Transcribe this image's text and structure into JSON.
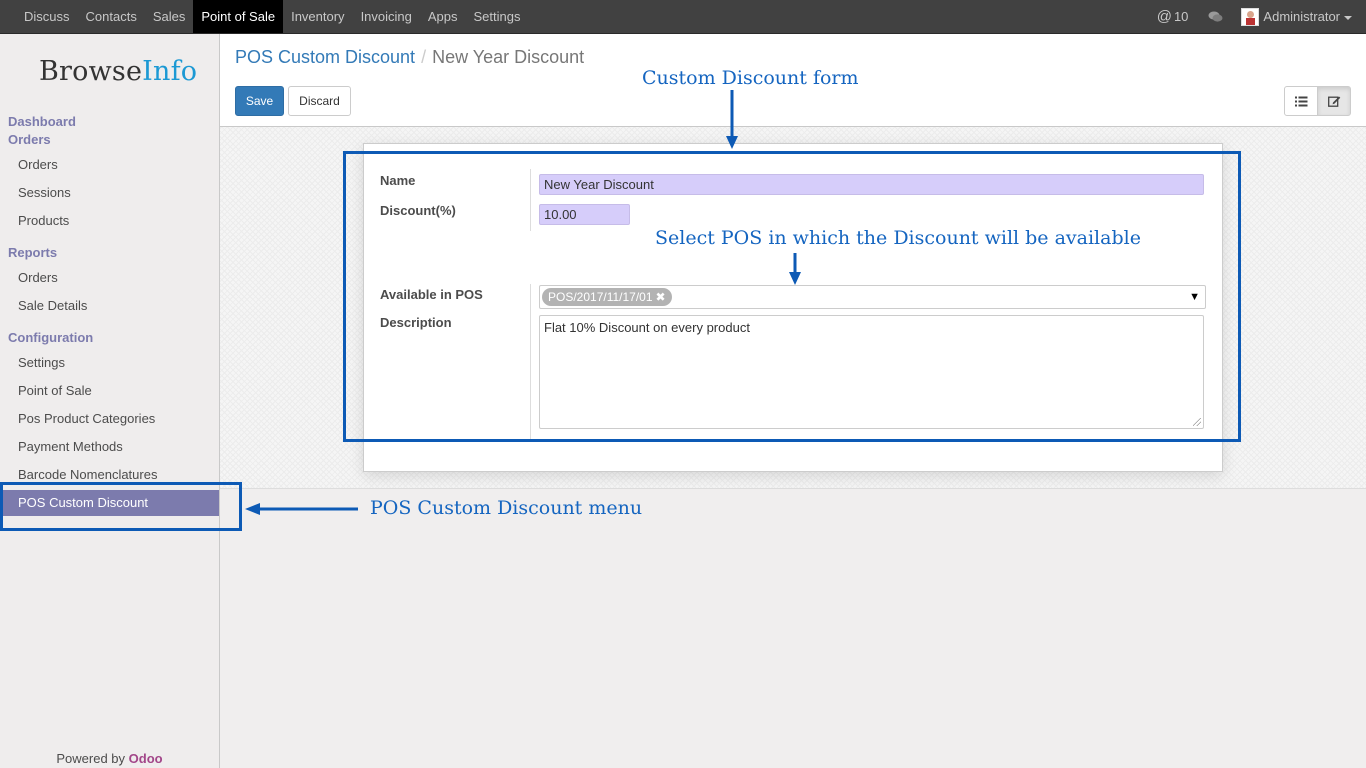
{
  "topbar": {
    "nav": [
      {
        "label": "Discuss"
      },
      {
        "label": "Contacts"
      },
      {
        "label": "Sales"
      },
      {
        "label": "Point of Sale",
        "active": true
      },
      {
        "label": "Inventory"
      },
      {
        "label": "Invoicing"
      },
      {
        "label": "Apps"
      },
      {
        "label": "Settings"
      }
    ],
    "mention_count": "10",
    "user_name": "Administrator"
  },
  "sidebar": {
    "logo_browse": "Browse",
    "logo_info": "Info",
    "sections": [
      {
        "label": "Dashboard"
      },
      {
        "label": "Orders",
        "items": [
          "Orders",
          "Sessions",
          "Products"
        ]
      },
      {
        "label": "Reports",
        "items": [
          "Orders",
          "Sale Details"
        ]
      },
      {
        "label": "Configuration",
        "items": [
          "Settings",
          "Point of Sale",
          "Pos Product Categories",
          "Payment Methods",
          "Barcode Nomenclatures",
          "POS Custom Discount"
        ]
      }
    ],
    "active_item": "POS Custom Discount",
    "powered_by": "Powered by",
    "powered_brand": "Odoo"
  },
  "controlpanel": {
    "breadcrumb_parent": "POS Custom Discount",
    "breadcrumb_separator": "/",
    "breadcrumb_current": "New Year Discount",
    "save_label": "Save",
    "discard_label": "Discard",
    "view_icons": [
      "list-view-icon",
      "form-view-icon"
    ]
  },
  "form": {
    "name_label": "Name",
    "name_value": "New Year Discount",
    "discount_label": "Discount(%)",
    "discount_value": "10.00",
    "available_label": "Available in POS",
    "pos_tag": "POS/2017/11/17/01",
    "description_label": "Description",
    "description_value": "Flat 10% Discount on every product"
  },
  "annotations": {
    "form_note": "Custom Discount form",
    "pos_note": "Select POS in which the Discount will be available",
    "menu_note": "POS Custom Discount menu"
  },
  "colors": {
    "topbar_bg": "#414141",
    "sidebar_accent": "#7c7bad",
    "primary_button": "#337ab7",
    "required_field": "#d6cdfa",
    "annotation": "#0d5ab5",
    "brand_info": "#1c99d4",
    "brand_odoo": "#a24689"
  }
}
